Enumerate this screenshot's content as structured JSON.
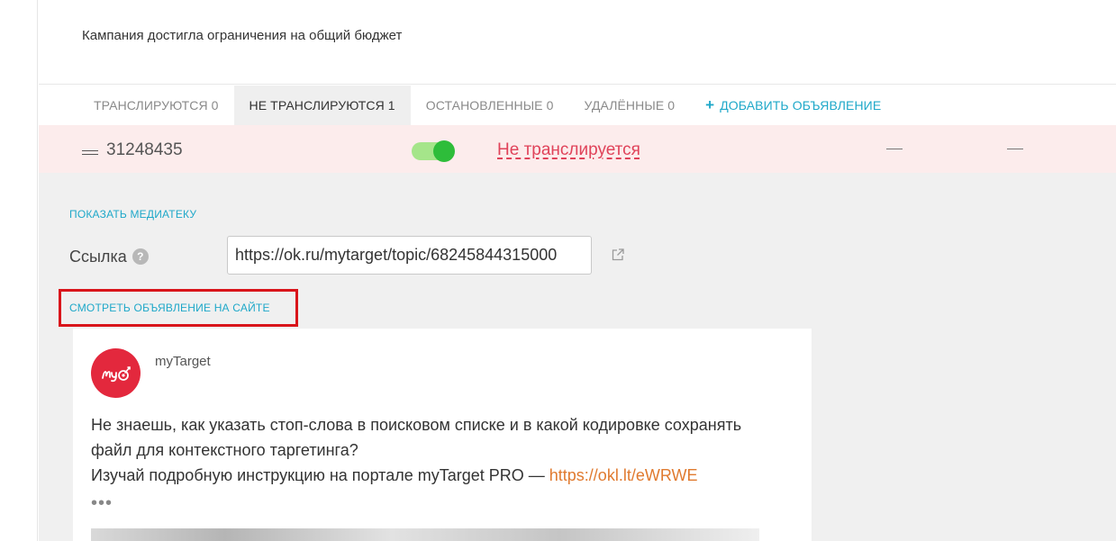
{
  "notice": {
    "text": "Кампания достигла ограничения на общий бюджет"
  },
  "tabs": [
    {
      "label": "ТРАНСЛИРУЮТСЯ 0"
    },
    {
      "label": "НЕ ТРАНСЛИРУЮТСЯ 1"
    },
    {
      "label": "ОСТАНОВЛЕННЫЕ 0"
    },
    {
      "label": "УДАЛЁННЫЕ 0"
    }
  ],
  "add_ad": {
    "plus": "+",
    "label": "ДОБАВИТЬ ОБЪЯВЛЕНИЕ"
  },
  "ad_row": {
    "id": "31248435",
    "status": "Не транслируется",
    "toggle_on": true,
    "colors": {
      "status": "#e0435a",
      "toggle": "#2ebd3a",
      "row_bg": "#fcecec"
    }
  },
  "media": {
    "show_label": "ПОКАЗАТЬ МЕДИАТЕКУ"
  },
  "link_field": {
    "label": "Ссылка",
    "help": "?",
    "value": "https://ok.ru/mytarget/topic/68245844315000",
    "external_icon": "external-link-icon"
  },
  "view_on_site": {
    "label": "СМОТРЕТЬ ОБЪЯВЛЕНИЕ НА САЙТЕ",
    "highlight_color": "#d9151b"
  },
  "post": {
    "author": "myTarget",
    "line1": "Не знаешь, как указать стоп-слова в поисковом списке и в какой кодировке сохранять",
    "line2": "файл для контекстного таргетинга?",
    "line3": "Изучай подробную инструкцию на портале myTarget PRO — ",
    "link": "https://okl.lt/eWRWE",
    "more": "•••"
  },
  "accent_color": "#1fa8c9"
}
